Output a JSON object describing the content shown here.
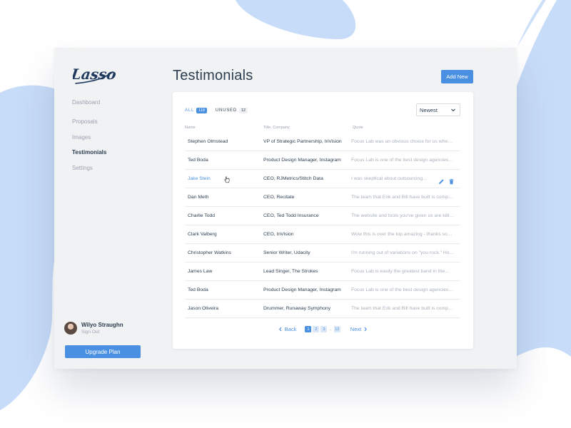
{
  "app": {
    "logo_text": "Lasso"
  },
  "colors": {
    "accent": "#4a90e2",
    "background_blob": "#c7dcf9",
    "text": "#2c3e50",
    "muted": "#9aa3b0"
  },
  "sidebar": {
    "items": [
      {
        "label": "Dashboard",
        "active": false
      },
      {
        "label": "Proposals",
        "active": false
      },
      {
        "label": "Images",
        "active": false
      },
      {
        "label": "Testimonials",
        "active": true
      },
      {
        "label": "Settings",
        "active": false
      }
    ],
    "user": {
      "name": "Wilyo Straughn",
      "signout_label": "Sign Out"
    },
    "upgrade_label": "Upgrade Plan"
  },
  "header": {
    "title": "Testimonials",
    "add_label": "Add New"
  },
  "filters": [
    {
      "label": "ALL",
      "count": "119",
      "active": true
    },
    {
      "label": "UNUSED",
      "count": "12",
      "active": false
    }
  ],
  "sort": {
    "selected": "Newest"
  },
  "table": {
    "columns": [
      "Name",
      "Title, Company",
      "Quote"
    ],
    "rows": [
      {
        "name": "Stephen Olmstead",
        "title": "VP of Strategic Partnership, InVision",
        "quote": "Focus Lab was an obvious choice for us when…"
      },
      {
        "name": "Ted Boda",
        "title": "Product Design Manager, Instagram",
        "quote": "Focus Lab is one of the best design agencies…"
      },
      {
        "name": "Jake Stein",
        "title": "CEO, RJMetrics/Stitch Data",
        "quote": "I was skeptical about outsourcing…",
        "hover": true
      },
      {
        "name": "Dan Meth",
        "title": "CEO, Recitate",
        "quote": "The team that Erik and Bill have built is compris…"
      },
      {
        "name": "Charlie Todd",
        "title": "CEO, Ted Todd Insurance",
        "quote": "The website and tools you've given us are killi…"
      },
      {
        "name": "Clark Valberg",
        "title": "CEO, InVision",
        "quote": "Wow this is over the top amazing - thanks so…"
      },
      {
        "name": "Christopher Watkins",
        "title": "Senior Writer, Udacity",
        "quote": "I'm running out of variations on \"you rock.\" How…"
      },
      {
        "name": "James Law",
        "title": "Lead Singer, The Strokes",
        "quote": "Focus Lab is easily the greatest band in the…"
      },
      {
        "name": "Ted Boda",
        "title": "Product Design Manager, Instagram",
        "quote": "Focus Lab is one of the best design agencies…"
      },
      {
        "name": "Jason Oliveira",
        "title": "Drummer, Runaway Symphony",
        "quote": "The team that Erik and Bill have built is compris…"
      }
    ]
  },
  "pagination": {
    "back_label": "Back",
    "next_label": "Next",
    "pages": [
      "1",
      "2",
      "3"
    ],
    "ellipsis": "..",
    "last_page": "12",
    "current": "1"
  }
}
